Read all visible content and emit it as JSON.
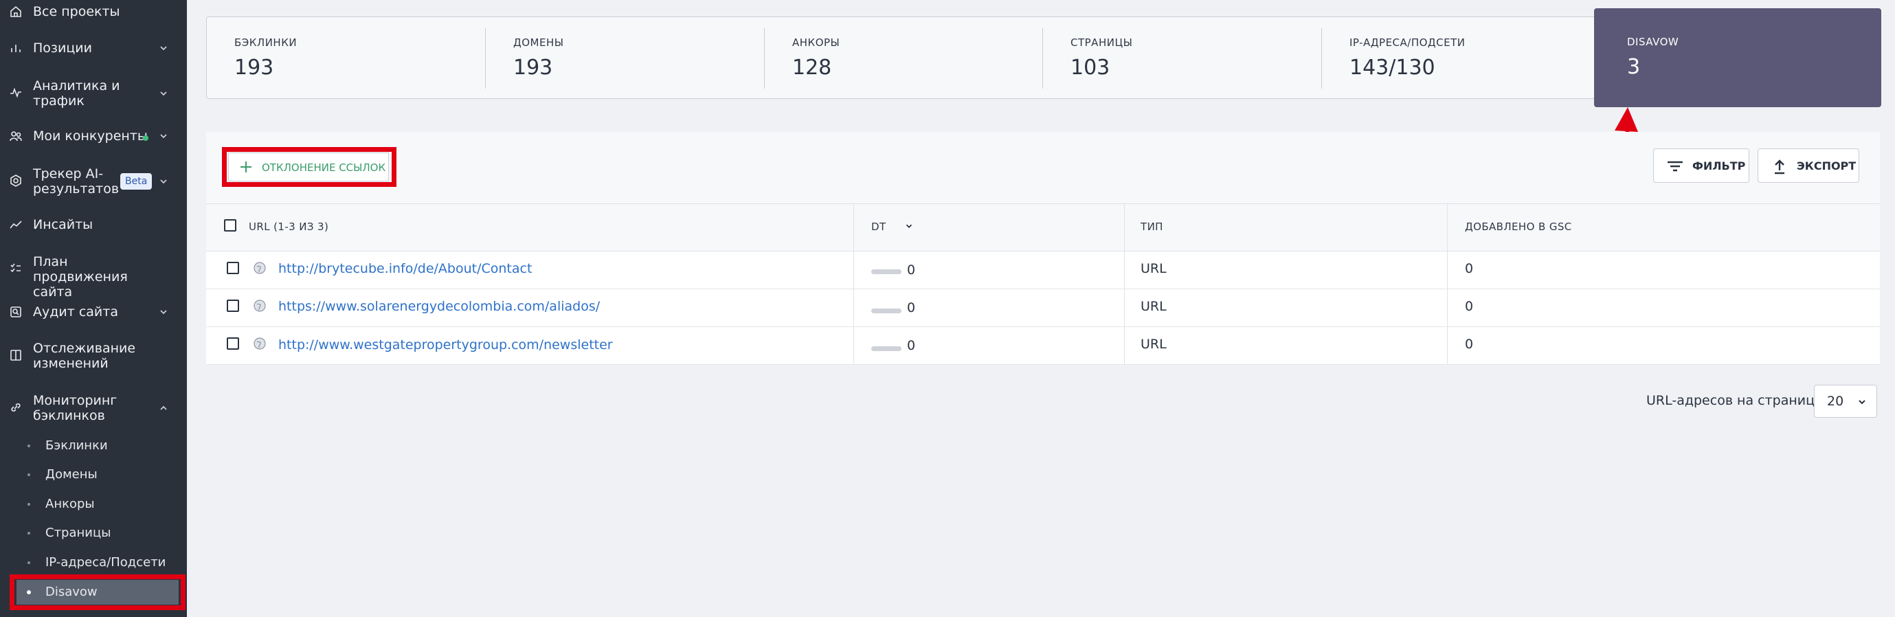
{
  "sidebar": {
    "items": [
      {
        "label": "Все проекты",
        "icon": "home-icon"
      },
      {
        "label": "Позиции",
        "icon": "bar-chart-icon"
      },
      {
        "label": "Аналитика и трафик",
        "icon": "pulse-icon"
      },
      {
        "label": "Мои конкуренты",
        "icon": "users-icon"
      },
      {
        "label": "Трекер AI-результатов",
        "icon": "ai-tracker-icon",
        "badge": "Beta"
      },
      {
        "label": "Инсайты",
        "icon": "trend-icon"
      },
      {
        "label": "План продвижения сайта",
        "icon": "checklist-icon"
      },
      {
        "label": "Аудит сайта",
        "icon": "audit-icon"
      },
      {
        "label": "Отслеживание изменений",
        "icon": "split-icon"
      },
      {
        "label": "Мониторинг бэклинков",
        "icon": "link-icon"
      }
    ],
    "subitems": [
      "Бэклинки",
      "Домены",
      "Анкоры",
      "Страницы",
      "IP-адреса/Подсети",
      "Disavow"
    ],
    "active_subitem": "Disavow"
  },
  "stats": [
    {
      "label": "БЭКЛИНКИ",
      "value": "193"
    },
    {
      "label": "ДОМЕНЫ",
      "value": "193"
    },
    {
      "label": "АНКОРЫ",
      "value": "128"
    },
    {
      "label": "СТРАНИЦЫ",
      "value": "103"
    },
    {
      "label": "IP-АДРЕСА/ПОДСЕТИ",
      "value": "143/130"
    },
    {
      "label": "DISAVOW",
      "value": "3"
    }
  ],
  "toolbar": {
    "add_label": "ОТКЛОНЕНИЕ ССЫЛОК",
    "filter_label": "ФИЛЬТР",
    "export_label": "ЭКСПОРТ"
  },
  "table": {
    "columns": [
      "URL (1-3 ИЗ 3)",
      "DT",
      "ТИП",
      "ДОБАВЛЕНО В GSC"
    ],
    "rows": [
      {
        "url": "http://brytecube.info/de/About/Contact",
        "dt": "0",
        "type": "URL",
        "gsc": "0"
      },
      {
        "url": "https://www.solarenergydecolombia.com/aliados/",
        "dt": "0",
        "type": "URL",
        "gsc": "0"
      },
      {
        "url": "http://www.westgatepropertygroup.com/newsletter",
        "dt": "0",
        "type": "URL",
        "gsc": "0"
      }
    ]
  },
  "pagination": {
    "label": "URL-адресов на странице:",
    "value": "20"
  },
  "colors": {
    "accent_green": "#3a9c6a",
    "disavow_bg": "#5b5776",
    "link": "#2e72c9",
    "annotation_red": "#e00012"
  }
}
